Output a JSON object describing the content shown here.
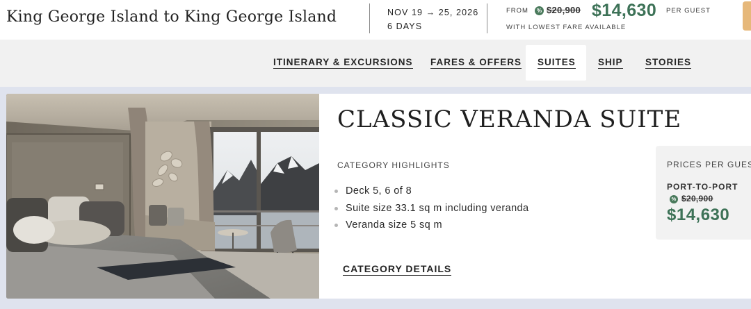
{
  "header": {
    "route_title": "King George Island to King George Island",
    "dates": "NOV 19 → 25, 2026",
    "duration": "6 DAYS",
    "from_label": "FROM",
    "discount_icon": "percent-badge-icon",
    "original_price": "$20,900",
    "price": "$14,630",
    "per_guest": "PER GUEST",
    "lowest_fare": "WITH LOWEST FARE AVAILABLE"
  },
  "nav": {
    "tabs": [
      {
        "label": "ITINERARY & EXCURSIONS",
        "active": false
      },
      {
        "label": "FARES & OFFERS",
        "active": false
      },
      {
        "label": "SUITES",
        "active": true
      },
      {
        "label": "SHIP",
        "active": false
      },
      {
        "label": "STORIES",
        "active": false
      }
    ]
  },
  "suite": {
    "title": "CLASSIC VERANDA SUITE",
    "highlights_heading": "CATEGORY HIGHLIGHTS",
    "highlights": [
      "Deck 5, 6 of 8",
      "Suite size 33.1 sq m including veranda",
      "Veranda size 5 sq m"
    ],
    "details_link": "CATEGORY DETAILS",
    "image": "suite-interior-photo"
  },
  "price_box": {
    "heading": "PRICES PER GUEST",
    "fare_type": "PORT-TO-PORT",
    "original_price": "$20,900",
    "price": "$14,630"
  },
  "colors": {
    "price_green": "#3d7257",
    "badge_green": "#4a7a5c",
    "nav_bg": "#f1f1f1",
    "band_bg": "#dfe3ee",
    "cta_accent": "#e6b87a"
  }
}
